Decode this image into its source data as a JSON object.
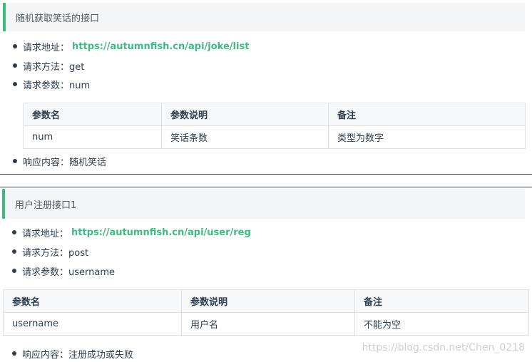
{
  "section1": {
    "title": "随机获取笑话的接口",
    "address_label": "请求地址：",
    "address_url": "https://autumnfish.cn/api/joke/list",
    "method_label": "请求方法：get",
    "params_label": "请求参数：num",
    "table": {
      "headers": [
        "参数名",
        "参数说明",
        "备注"
      ],
      "rows": [
        [
          "num",
          "笑话条数",
          "类型为数字"
        ]
      ]
    },
    "response_label": "响应内容：随机笑话"
  },
  "section2": {
    "title": "用户注册接口1",
    "address_label": "请求地址：",
    "address_url": "https://autumnfish.cn/api/user/reg",
    "method_label": "请求方法：post",
    "params_label": "请求参数：username",
    "table": {
      "headers": [
        "参数名",
        "参数说明",
        "备注"
      ],
      "rows": [
        [
          "username",
          "用户名",
          "不能为空"
        ]
      ]
    },
    "response_label": "响应内容：注册成功或失败"
  },
  "watermark": "https://blog.csdn.net/Chen_0218",
  "colors": {
    "accent": "#42b983",
    "text": "#2c3e50",
    "tip_bg": "#f3f5f7"
  }
}
